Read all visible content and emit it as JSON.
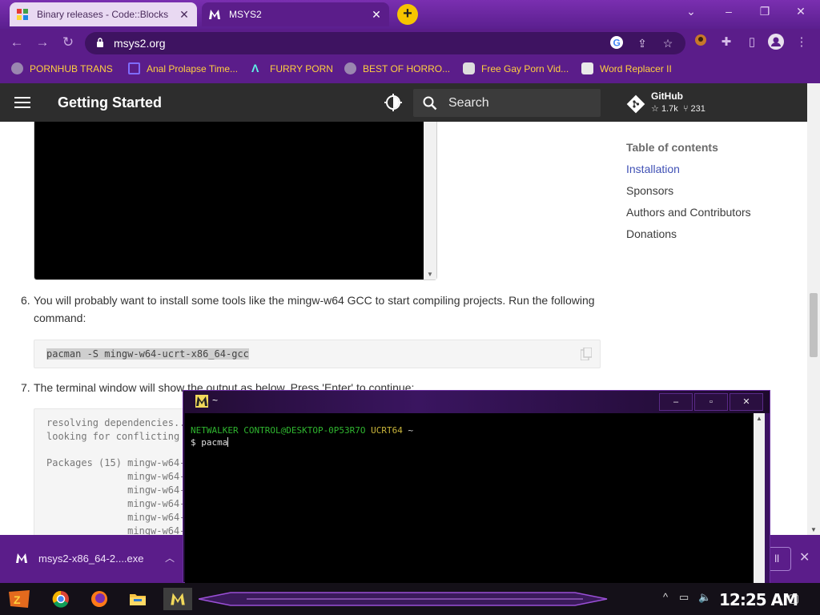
{
  "browser": {
    "tabs": [
      {
        "title": "Binary releases - Code::Blocks",
        "active": false
      },
      {
        "title": "MSYS2",
        "active": true
      }
    ],
    "new_tab": "+",
    "url": "msys2.org",
    "bookmarks": [
      {
        "label": "PORNHUB TRANS",
        "icon": "globe-icon"
      },
      {
        "label": "Anal Prolapse Time...",
        "icon": "lightning-icon"
      },
      {
        "label": "FURRY PORN",
        "icon": "lambda-icon"
      },
      {
        "label": "BEST OF HORRO...",
        "icon": "globe-icon"
      },
      {
        "label": "Free Gay Porn Vid...",
        "icon": "skull-icon"
      },
      {
        "label": "Word Replacer II",
        "icon": "wr-extension-icon"
      }
    ],
    "accent": "#5b1d8a",
    "bookmark_color": "#ffcf3f"
  },
  "site": {
    "title": "Getting Started",
    "search_placeholder": "Search",
    "github": {
      "name": "GitHub",
      "stars": "1.7k",
      "forks": "231"
    }
  },
  "content": {
    "step6": {
      "num": "6.",
      "text": "You will probably want to install some tools like the mingw-w64 GCC to start compiling projects. Run the following command:",
      "code": "pacman -S mingw-w64-ucrt-x86_64-gcc"
    },
    "step7": {
      "num": "7.",
      "text": "The terminal window will show the output as below. Press 'Enter' to continue:",
      "code_lines": [
        "resolving dependencies...",
        "looking for conflicting",
        "",
        "Packages (15) mingw-w64-",
        "              mingw-w64-uc",
        "              mingw-w64-uc",
        "              mingw-w64-uc",
        "              mingw-w64-uc",
        "              mingw-w64-uc"
      ]
    }
  },
  "toc": {
    "heading": "Table of contents",
    "items": [
      {
        "label": "Installation",
        "active": true
      },
      {
        "label": "Sponsors",
        "active": false
      },
      {
        "label": "Authors and Contributors",
        "active": false
      },
      {
        "label": "Donations",
        "active": false
      }
    ]
  },
  "download": {
    "filename": "msys2-x86_64-2....exe",
    "show_all": "ll"
  },
  "terminal": {
    "title": "~",
    "user": "NETWALKER CONTROL@DESKTOP-0P53R7O",
    "env": "UCRT64",
    "path": "~",
    "prompt": "$ pacma",
    "minimize": "–",
    "maximize": "▫",
    "close": "✕"
  },
  "taskbar": {
    "clock": "12:25 AM"
  }
}
